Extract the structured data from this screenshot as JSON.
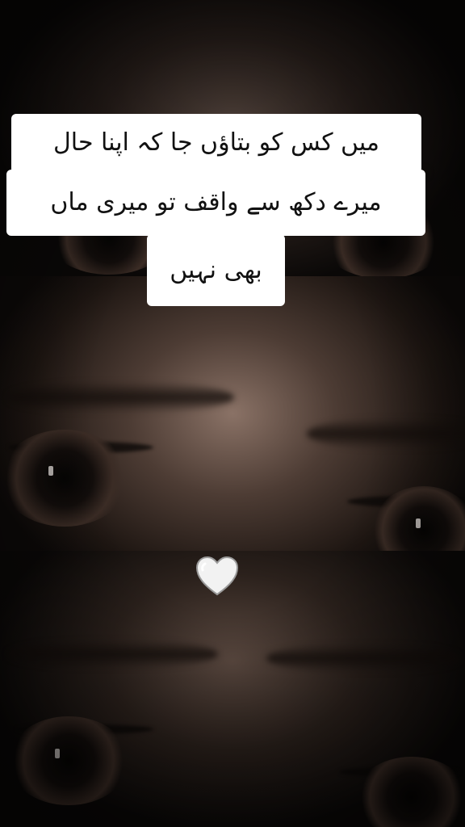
{
  "caption": {
    "lines": [
      "میں کس کو بتاؤں جا کہ اپنا حال",
      "میرے دکھ سے واقف تو میری ماں",
      "بھی نہیں"
    ]
  },
  "emoji": {
    "name": "white-heart-icon",
    "glyph": "🤍"
  }
}
